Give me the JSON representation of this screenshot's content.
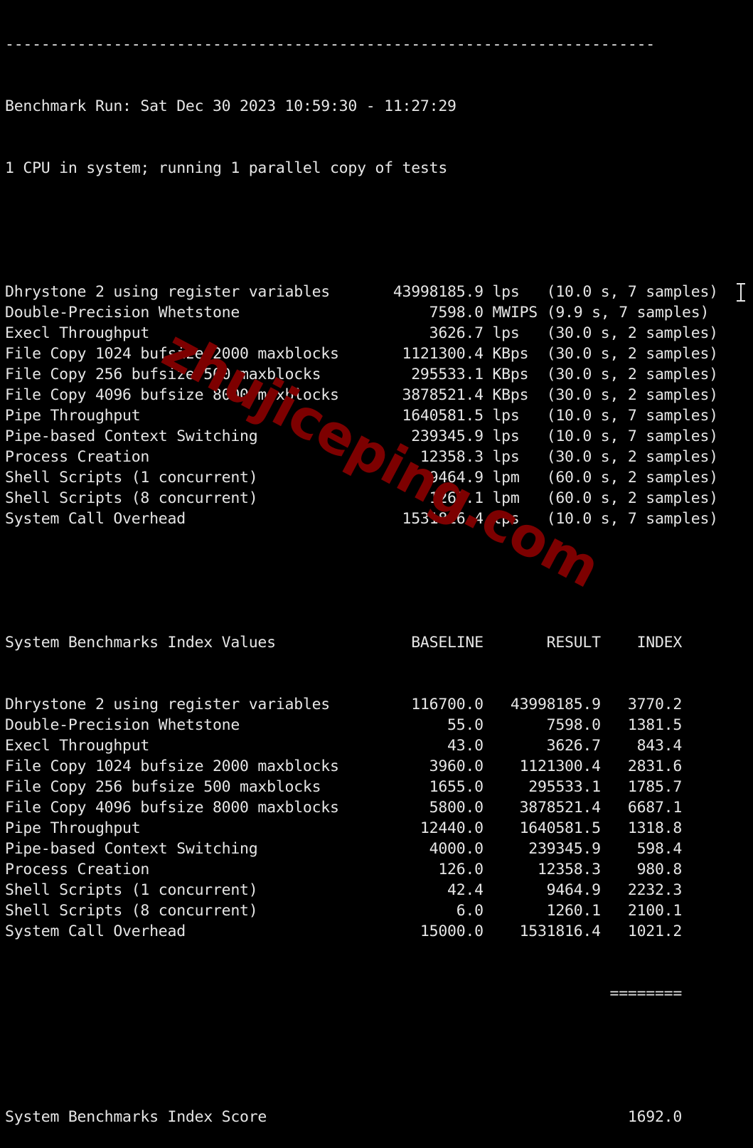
{
  "terminal": {
    "separator": "------------------------------------------------------------------------",
    "run_header": "Benchmark Run: Sat Dec 30 2023 10:59:30 - 11:27:29",
    "cpu_info": "1 CPU in system; running 1 parallel copy of tests",
    "raw_results": [
      {
        "name": "Dhrystone 2 using register variables",
        "value": "43998185.9",
        "unit": "lps",
        "detail": "(10.0 s, 7 samples)"
      },
      {
        "name": "Double-Precision Whetstone",
        "value": "7598.0",
        "unit": "MWIPS",
        "detail": "(9.9 s, 7 samples)"
      },
      {
        "name": "Execl Throughput",
        "value": "3626.7",
        "unit": "lps",
        "detail": "(30.0 s, 2 samples)"
      },
      {
        "name": "File Copy 1024 bufsize 2000 maxblocks",
        "value": "1121300.4",
        "unit": "KBps",
        "detail": "(30.0 s, 2 samples)"
      },
      {
        "name": "File Copy 256 bufsize 500 maxblocks",
        "value": "295533.1",
        "unit": "KBps",
        "detail": "(30.0 s, 2 samples)"
      },
      {
        "name": "File Copy 4096 bufsize 8000 maxblocks",
        "value": "3878521.4",
        "unit": "KBps",
        "detail": "(30.0 s, 2 samples)"
      },
      {
        "name": "Pipe Throughput",
        "value": "1640581.5",
        "unit": "lps",
        "detail": "(10.0 s, 7 samples)"
      },
      {
        "name": "Pipe-based Context Switching",
        "value": "239345.9",
        "unit": "lps",
        "detail": "(10.0 s, 7 samples)"
      },
      {
        "name": "Process Creation",
        "value": "12358.3",
        "unit": "lps",
        "detail": "(30.0 s, 2 samples)"
      },
      {
        "name": "Shell Scripts (1 concurrent)",
        "value": "9464.9",
        "unit": "lpm",
        "detail": "(60.0 s, 2 samples)"
      },
      {
        "name": "Shell Scripts (8 concurrent)",
        "value": "1260.1",
        "unit": "lpm",
        "detail": "(60.0 s, 2 samples)"
      },
      {
        "name": "System Call Overhead",
        "value": "1531816.4",
        "unit": "lps",
        "detail": "(10.0 s, 7 samples)"
      }
    ],
    "index_header": {
      "title": "System Benchmarks Index Values",
      "baseline": "BASELINE",
      "result": "RESULT",
      "index": "INDEX"
    },
    "index_rows": [
      {
        "name": "Dhrystone 2 using register variables",
        "baseline": "116700.0",
        "result": "43998185.9",
        "index": "3770.2"
      },
      {
        "name": "Double-Precision Whetstone",
        "baseline": "55.0",
        "result": "7598.0",
        "index": "1381.5"
      },
      {
        "name": "Execl Throughput",
        "baseline": "43.0",
        "result": "3626.7",
        "index": "843.4"
      },
      {
        "name": "File Copy 1024 bufsize 2000 maxblocks",
        "baseline": "3960.0",
        "result": "1121300.4",
        "index": "2831.6"
      },
      {
        "name": "File Copy 256 bufsize 500 maxblocks",
        "baseline": "1655.0",
        "result": "295533.1",
        "index": "1785.7"
      },
      {
        "name": "File Copy 4096 bufsize 8000 maxblocks",
        "baseline": "5800.0",
        "result": "3878521.4",
        "index": "6687.1"
      },
      {
        "name": "Pipe Throughput",
        "baseline": "12440.0",
        "result": "1640581.5",
        "index": "1318.8"
      },
      {
        "name": "Pipe-based Context Switching",
        "baseline": "4000.0",
        "result": "239345.9",
        "index": "598.4"
      },
      {
        "name": "Process Creation",
        "baseline": "126.0",
        "result": "12358.3",
        "index": "980.8"
      },
      {
        "name": "Shell Scripts (1 concurrent)",
        "baseline": "42.4",
        "result": "9464.9",
        "index": "2232.3"
      },
      {
        "name": "Shell Scripts (8 concurrent)",
        "baseline": "6.0",
        "result": "1260.1",
        "index": "2100.1"
      },
      {
        "name": "System Call Overhead",
        "baseline": "15000.0",
        "result": "1531816.4",
        "index": "1021.2"
      }
    ],
    "score_rule": "========",
    "score_label": "System Benchmarks Index Score",
    "score_value": "1692.0"
  },
  "watermark": "zhujiceping.com"
}
